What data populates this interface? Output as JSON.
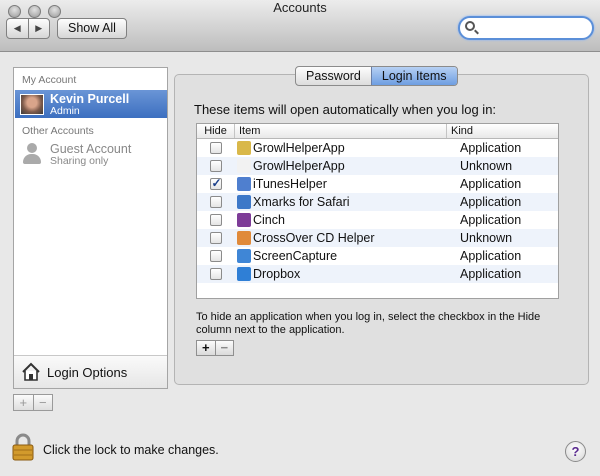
{
  "window": {
    "title": "Accounts",
    "show_all": "Show All",
    "back": "◀",
    "forward": "▶"
  },
  "search": {
    "value": "",
    "placeholder": ""
  },
  "sidebar": {
    "my_account_heading": "My Account",
    "other_accounts_heading": "Other Accounts",
    "accounts": [
      {
        "name": "Kevin Purcell",
        "role": "Admin"
      },
      {
        "name": "Guest Account",
        "role": "Sharing only"
      }
    ],
    "login_options": "Login Options",
    "add": "+",
    "remove": "−"
  },
  "tabs": [
    {
      "label": "Password"
    },
    {
      "label": "Login Items"
    }
  ],
  "main": {
    "intro": "These items will open automatically when you log in:",
    "columns": {
      "hide": "Hide",
      "item": "Item",
      "kind": "Kind"
    },
    "items": [
      {
        "name": "GrowlHelperApp",
        "kind": "Application",
        "hide": false,
        "icon": "growl-icon",
        "color": "#d9b84a"
      },
      {
        "name": "GrowlHelperApp",
        "kind": "Unknown",
        "hide": false,
        "icon": "document-icon",
        "color": "#f2f2f2"
      },
      {
        "name": "iTunesHelper",
        "kind": "Application",
        "hide": true,
        "icon": "itunes-icon",
        "color": "#4f7fcf"
      },
      {
        "name": "Xmarks for Safari",
        "kind": "Application",
        "hide": false,
        "icon": "xmarks-icon",
        "color": "#3d78c8"
      },
      {
        "name": "Cinch",
        "kind": "Application",
        "hide": false,
        "icon": "cinch-icon",
        "color": "#7d3c98"
      },
      {
        "name": "CrossOver CD Helper",
        "kind": "Unknown",
        "hide": false,
        "icon": "crossover-icon",
        "color": "#e08a3a"
      },
      {
        "name": "ScreenCapture",
        "kind": "Application",
        "hide": false,
        "icon": "screencapture-icon",
        "color": "#3f86d6"
      },
      {
        "name": "Dropbox",
        "kind": "Application",
        "hide": false,
        "icon": "dropbox-icon",
        "color": "#2f7fd6"
      }
    ],
    "hint": "To hide an application when you log in, select the checkbox in the Hide column next to the application.",
    "add": "+",
    "remove": "−"
  },
  "footer": {
    "lock_message": "Click the lock to make changes.",
    "help": "?"
  }
}
